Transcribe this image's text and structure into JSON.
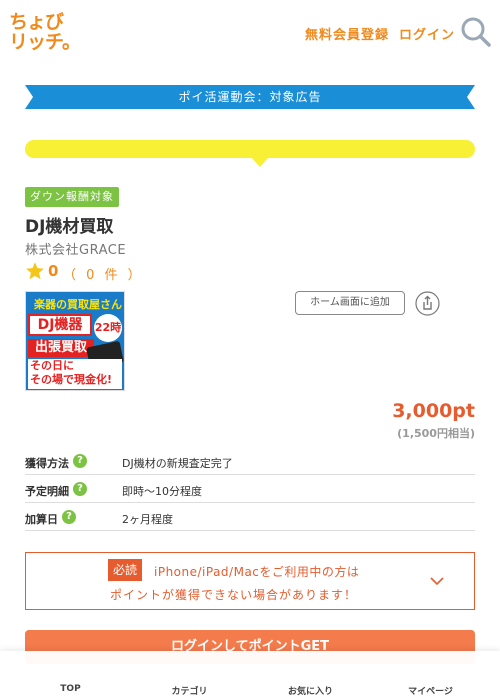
{
  "header": {
    "logo_line1": "ちょび",
    "logo_line2": "リッチ。",
    "register_label": "無料会員登録",
    "login_label": "ログイン",
    "search_icon": "search-icon"
  },
  "campaign_ribbon": "ポイ活運動会：対象広告",
  "ad": {
    "badge": "ダウン報酬対象",
    "title": "DJ機材買取",
    "company": "株式会社GRACE",
    "rating_score": "0",
    "rating_count": "（ 0 件 ）",
    "banner": {
      "line1": "楽器の買取屋さん",
      "line2": "DJ機器",
      "line3": "22時",
      "line4": "出張買取",
      "line5": "その日に",
      "line6": "その場で現金化!"
    },
    "home_button": "ホーム画面に追加",
    "points": "3,000pt",
    "points_yen": "(1,500円相当)"
  },
  "details": [
    {
      "label": "獲得方法",
      "value": "DJ機材の新規査定完了"
    },
    {
      "label": "予定明細",
      "value": "即時～10分程度"
    },
    {
      "label": "加算日",
      "value": "2ヶ月程度"
    }
  ],
  "help_mark": "?",
  "notice": {
    "required": "必読",
    "line1": "iPhone/iPad/Macをご利用中の方は",
    "line2": "ポイントが獲得できない場合があります！"
  },
  "cta_label": "ログインしてポイントGET",
  "bottom_nav": [
    {
      "label": "TOP"
    },
    {
      "label": "カテゴリ"
    },
    {
      "label": "お気に入り"
    },
    {
      "label": "マイページ"
    }
  ],
  "colors": {
    "brand_orange": "#f08a1c",
    "accent_red": "#e65c2e",
    "ribbon_blue": "#1a8ed6",
    "badge_green": "#7cc243",
    "highlight_yellow": "#f7f035"
  }
}
